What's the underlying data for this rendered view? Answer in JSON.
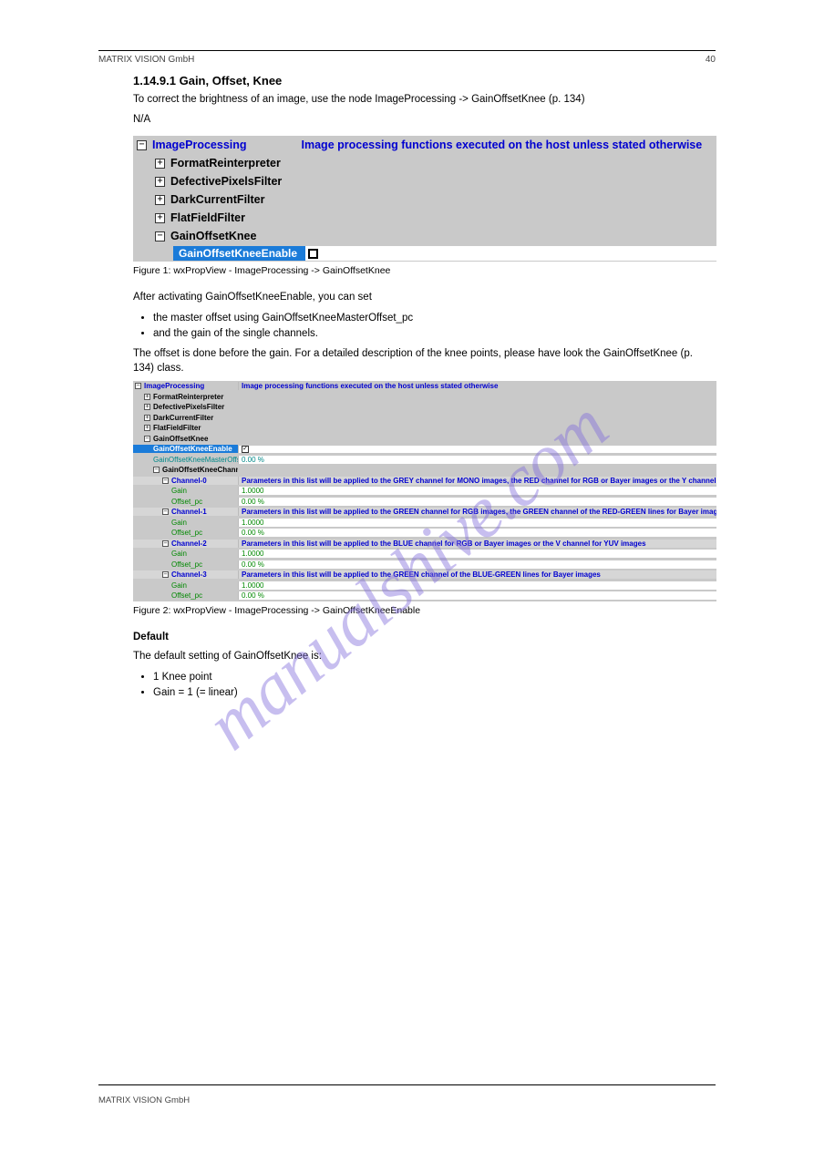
{
  "header": {
    "left": "MATRIX VISION GmbH",
    "right": "40"
  },
  "section": {
    "title": "1.14.9.1 Gain, Offset, Knee",
    "p1": "To correct the brightness of an image, use the node ImageProcessing -> GainOffsetKnee (p. 134)",
    "na": "N/A",
    "fig1_cap": "Figure 1: wxPropView - ImageProcessing -> GainOffsetKnee",
    "p2": "After activating GainOffsetKneeEnable, you can set",
    "bullets": [
      "the master offset using GainOffsetKneeMasterOffset_pc",
      "and the gain of the single channels."
    ],
    "p3": "The offset is done before the gain. For a detailed description of the knee points, please have look the GainOffsetKnee (p. 134) class.",
    "fig2_cap": "Figure 2: wxPropView - ImageProcessing -> GainOffsetKneeEnable",
    "default": "Default",
    "default_desc": "The default setting of GainOffsetKnee is:",
    "default_list": [
      "1 Knee point",
      "Gain = 1 (= linear)"
    ]
  },
  "fig1": {
    "root": "ImageProcessing",
    "root_desc": "Image processing functions executed on the host unless stated otherwise",
    "children": [
      "FormatReinterpreter",
      "DefectivePixelsFilter",
      "DarkCurrentFilter",
      "FlatFieldFilter"
    ],
    "knee": "GainOffsetKnee",
    "sel": "GainOffsetKneeEnable"
  },
  "fig2": {
    "root": "ImageProcessing",
    "root_desc": "Image processing functions executed on the host unless stated otherwise",
    "siblings": [
      "FormatReinterpreter",
      "DefectivePixelsFilter",
      "DarkCurrentFilter",
      "FlatFieldFilter"
    ],
    "knee": "GainOffsetKnee",
    "sel": "GainOffsetKneeEnable",
    "master_offset_label": "GainOffsetKneeMasterOffset_pc",
    "master_offset_val": "0.00 %",
    "channels_label": "GainOffsetKneeChannels",
    "channels": [
      {
        "name": "Channel-0",
        "desc": "Parameters in this list will be applied to the GREY channel for MONO images, the RED channel for RGB or Bayer images or the Y channel for YUV images"
      },
      {
        "name": "Channel-1",
        "desc": "Parameters in this list will be applied to the GREEN channel for RGB images, the GREEN channel of the RED-GREEN lines for Bayer images or the U channel for YUV images"
      },
      {
        "name": "Channel-2",
        "desc": "Parameters in this list will be applied to the BLUE channel for RGB or Bayer images or the V channel for YUV images"
      },
      {
        "name": "Channel-3",
        "desc": "Parameters in this list will be applied to the GREEN channel of the BLUE-GREEN lines for Bayer images"
      }
    ],
    "gain_label": "Gain",
    "gain_val": "1.0000",
    "offset_label": "Offset_pc",
    "offset_val": "0.00 %"
  },
  "footer": {
    "left": "MATRIX VISION GmbH",
    "right": ""
  },
  "watermark": "manualshive.com"
}
